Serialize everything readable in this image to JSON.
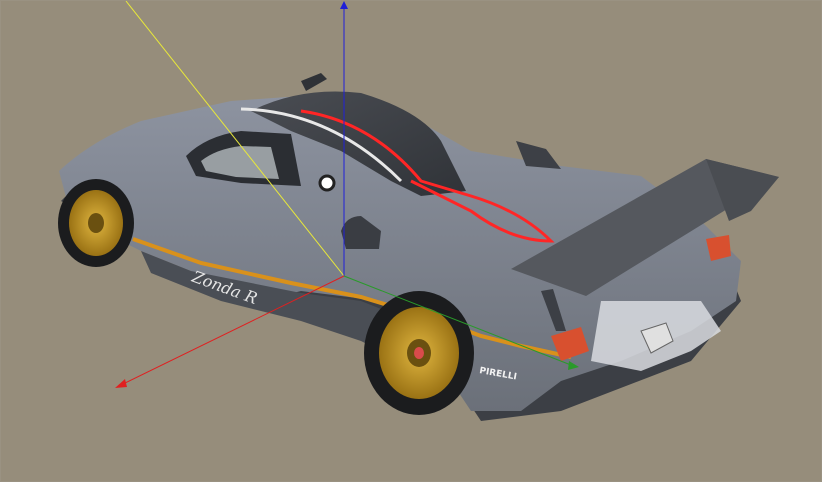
{
  "viewport": {
    "background": "#968d7b",
    "description_icons": [
      "axis-gizmo",
      "car-model"
    ]
  },
  "model": {
    "body_color": "#7d838f",
    "accent_stripe": "#d9911b",
    "wheel_color": "#b88c1c",
    "windshield_color": "#2b2e33",
    "side_text": "Zonda R",
    "tyre_brand": "PIRELLI"
  },
  "axes": {
    "x_color": "#e02020",
    "y_color": "#2a9a2a",
    "z_color": "#2020d8",
    "view_line_color": "#e8e83a"
  }
}
